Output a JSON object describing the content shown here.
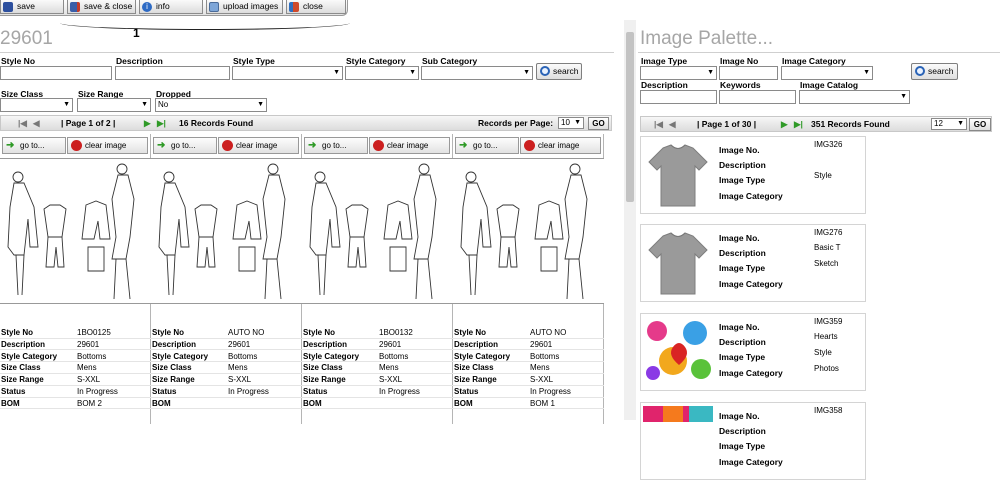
{
  "toolbar": {
    "buttons": [
      {
        "label": "save",
        "icon": "floppy-disk-icon"
      },
      {
        "label": "save & close",
        "icon": "save-close-icon"
      },
      {
        "label": "info",
        "icon": "info-icon"
      },
      {
        "label": "upload images",
        "icon": "upload-images-icon"
      },
      {
        "label": "close",
        "icon": "close-icon"
      }
    ],
    "page_number": "1"
  },
  "left": {
    "title": "29601",
    "filters": {
      "style_no": "Style No",
      "description": "Description",
      "style_type": "Style Type",
      "style_category": "Style Category",
      "sub_category": "Sub Category",
      "size_class": "Size Class",
      "size_range": "Size Range",
      "dropped": "Dropped",
      "dropped_value": "No",
      "search": "search"
    },
    "pager": {
      "page_text": "| Page 1 of 2 |",
      "records_found": "16  Records Found",
      "per_page_label": "Records per Page:",
      "per_page_value": "10",
      "go": "GO"
    },
    "card_buttons": {
      "goto": "go to...",
      "clear": "clear image"
    },
    "field_labels": [
      "Style No",
      "Description",
      "Style Category",
      "Size Class",
      "Size Range",
      "Status",
      "BOM"
    ],
    "cards": [
      {
        "values": [
          "1BO0125",
          "29601",
          "Bottoms",
          "Mens",
          "S-XXL",
          "In Progress",
          "BOM 2"
        ]
      },
      {
        "values": [
          "AUTO NO",
          "29601",
          "Bottoms",
          "Mens",
          "S-XXL",
          "In Progress",
          ""
        ]
      },
      {
        "values": [
          "1BO0132",
          "29601",
          "Bottoms",
          "Mens",
          "S-XXL",
          "In Progress",
          ""
        ]
      },
      {
        "values": [
          "AUTO NO",
          "29601",
          "Bottoms",
          "Mens",
          "S-XXL",
          "In Progress",
          "BOM 1"
        ]
      }
    ]
  },
  "right": {
    "title": "Image Palette...",
    "filters": {
      "image_type": "Image Type",
      "image_no": "Image No",
      "image_category": "Image Category",
      "description": "Description",
      "keywords": "Keywords",
      "image_catalog": "Image Catalog",
      "search": "search"
    },
    "pager": {
      "page_text": "| Page 1 of 30 |",
      "records_found": "351  Records Found",
      "per_page_value": "12",
      "go": "GO"
    },
    "item_labels": [
      "Image No.",
      "Description",
      "Image Type",
      "Image Category"
    ],
    "items": [
      {
        "image_no": "IMG326",
        "description": "",
        "image_type": "Style",
        "image_category": "",
        "kind": "gray-tshirt"
      },
      {
        "image_no": "IMG276",
        "description": "Basic T",
        "image_type": "Sketch",
        "image_category": "",
        "kind": "gray-tshirt"
      },
      {
        "image_no": "IMG359",
        "description": "Hearts",
        "image_type": "Style",
        "image_category": "Photos",
        "kind": "colorful-hearts"
      },
      {
        "image_no": "IMG358",
        "description": "",
        "image_type": "",
        "image_category": "",
        "kind": "colorful-pattern"
      }
    ]
  },
  "colors": {
    "title_gray": "#a6a6a6",
    "pager_bg": "#e4e4e4",
    "go_arrow": "#2f9a27",
    "clear_red": "#cc1f1f"
  }
}
